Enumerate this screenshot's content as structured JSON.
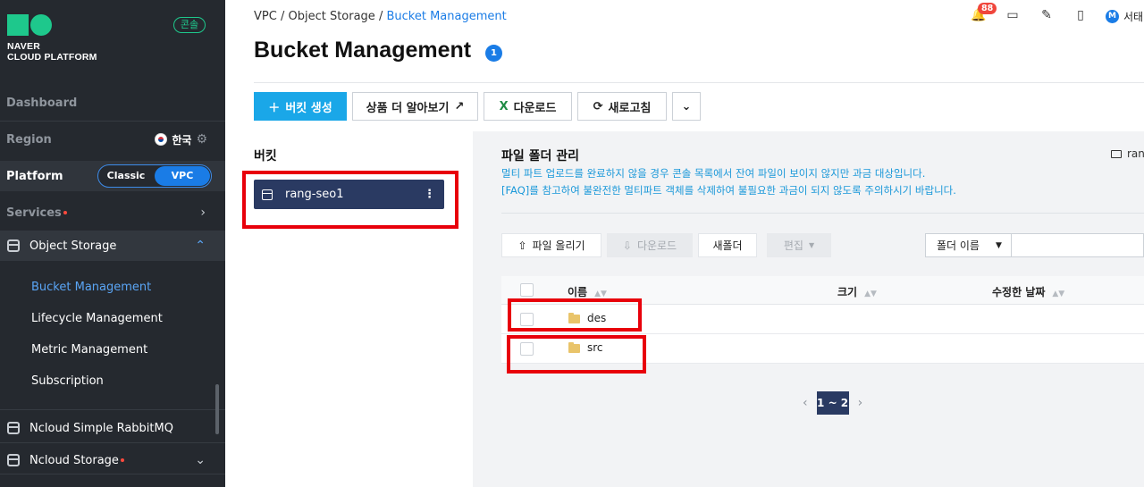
{
  "brand": {
    "line1": "NAVER",
    "line2": "CLOUD PLATFORM",
    "console_label": "콘솔"
  },
  "sidebar": {
    "dashboard": "Dashboard",
    "region_label": "Region",
    "region_value": "한국",
    "platform_label": "Platform",
    "platform_options": [
      "Classic",
      "VPC"
    ],
    "platform_selected": "VPC",
    "services": "Services",
    "object_storage": "Object Storage",
    "sub_items": [
      "Bucket Management",
      "Lifecycle Management",
      "Metric Management",
      "Subscription"
    ],
    "sub_active": "Bucket Management",
    "rabbitmq": "Ncloud Simple RabbitMQ",
    "ncloud_storage": "Ncloud Storage"
  },
  "breadcrumb": [
    "VPC",
    "Object Storage",
    "Bucket Management"
  ],
  "header": {
    "notification_count": "88",
    "user_initial": "M",
    "user_name": "서태"
  },
  "page": {
    "title": "Bucket Management",
    "count": "1"
  },
  "toolbar": {
    "create": "버킷 생성",
    "learn_more": "상품 더 알아보기",
    "download": "다운로드",
    "refresh": "새로고침"
  },
  "buckets": {
    "title": "버킷",
    "items": [
      {
        "name": "rang-seo1"
      }
    ]
  },
  "files": {
    "title": "파일 폴더 관리",
    "path": "rang",
    "note1": "멀티 파트 업로드를 완료하지 않을 경우 콘솔 목록에서 잔여 파일이 보이지 않지만 과금 대상입니다.",
    "note2": "[FAQ]를 참고하여 불완전한 멀티파트 객체를 삭제하여 불필요한 과금이 되지 않도록 주의하시기 바랍니다.",
    "upload": "파일 올리기",
    "download": "다운로드",
    "new_folder": "새폴더",
    "edit": "편집",
    "search_by": "폴더 이름",
    "columns": {
      "name": "이름",
      "size": "크기",
      "modified": "수정한 날짜"
    },
    "rows": [
      {
        "name": "des"
      },
      {
        "name": "src"
      }
    ],
    "pagination": "1 ~ 2"
  },
  "colors": {
    "accent": "#1a7ce6",
    "highlight": "#e8000b",
    "bucket_selected": "#2a3a62",
    "brand_green": "#1ec88c"
  }
}
